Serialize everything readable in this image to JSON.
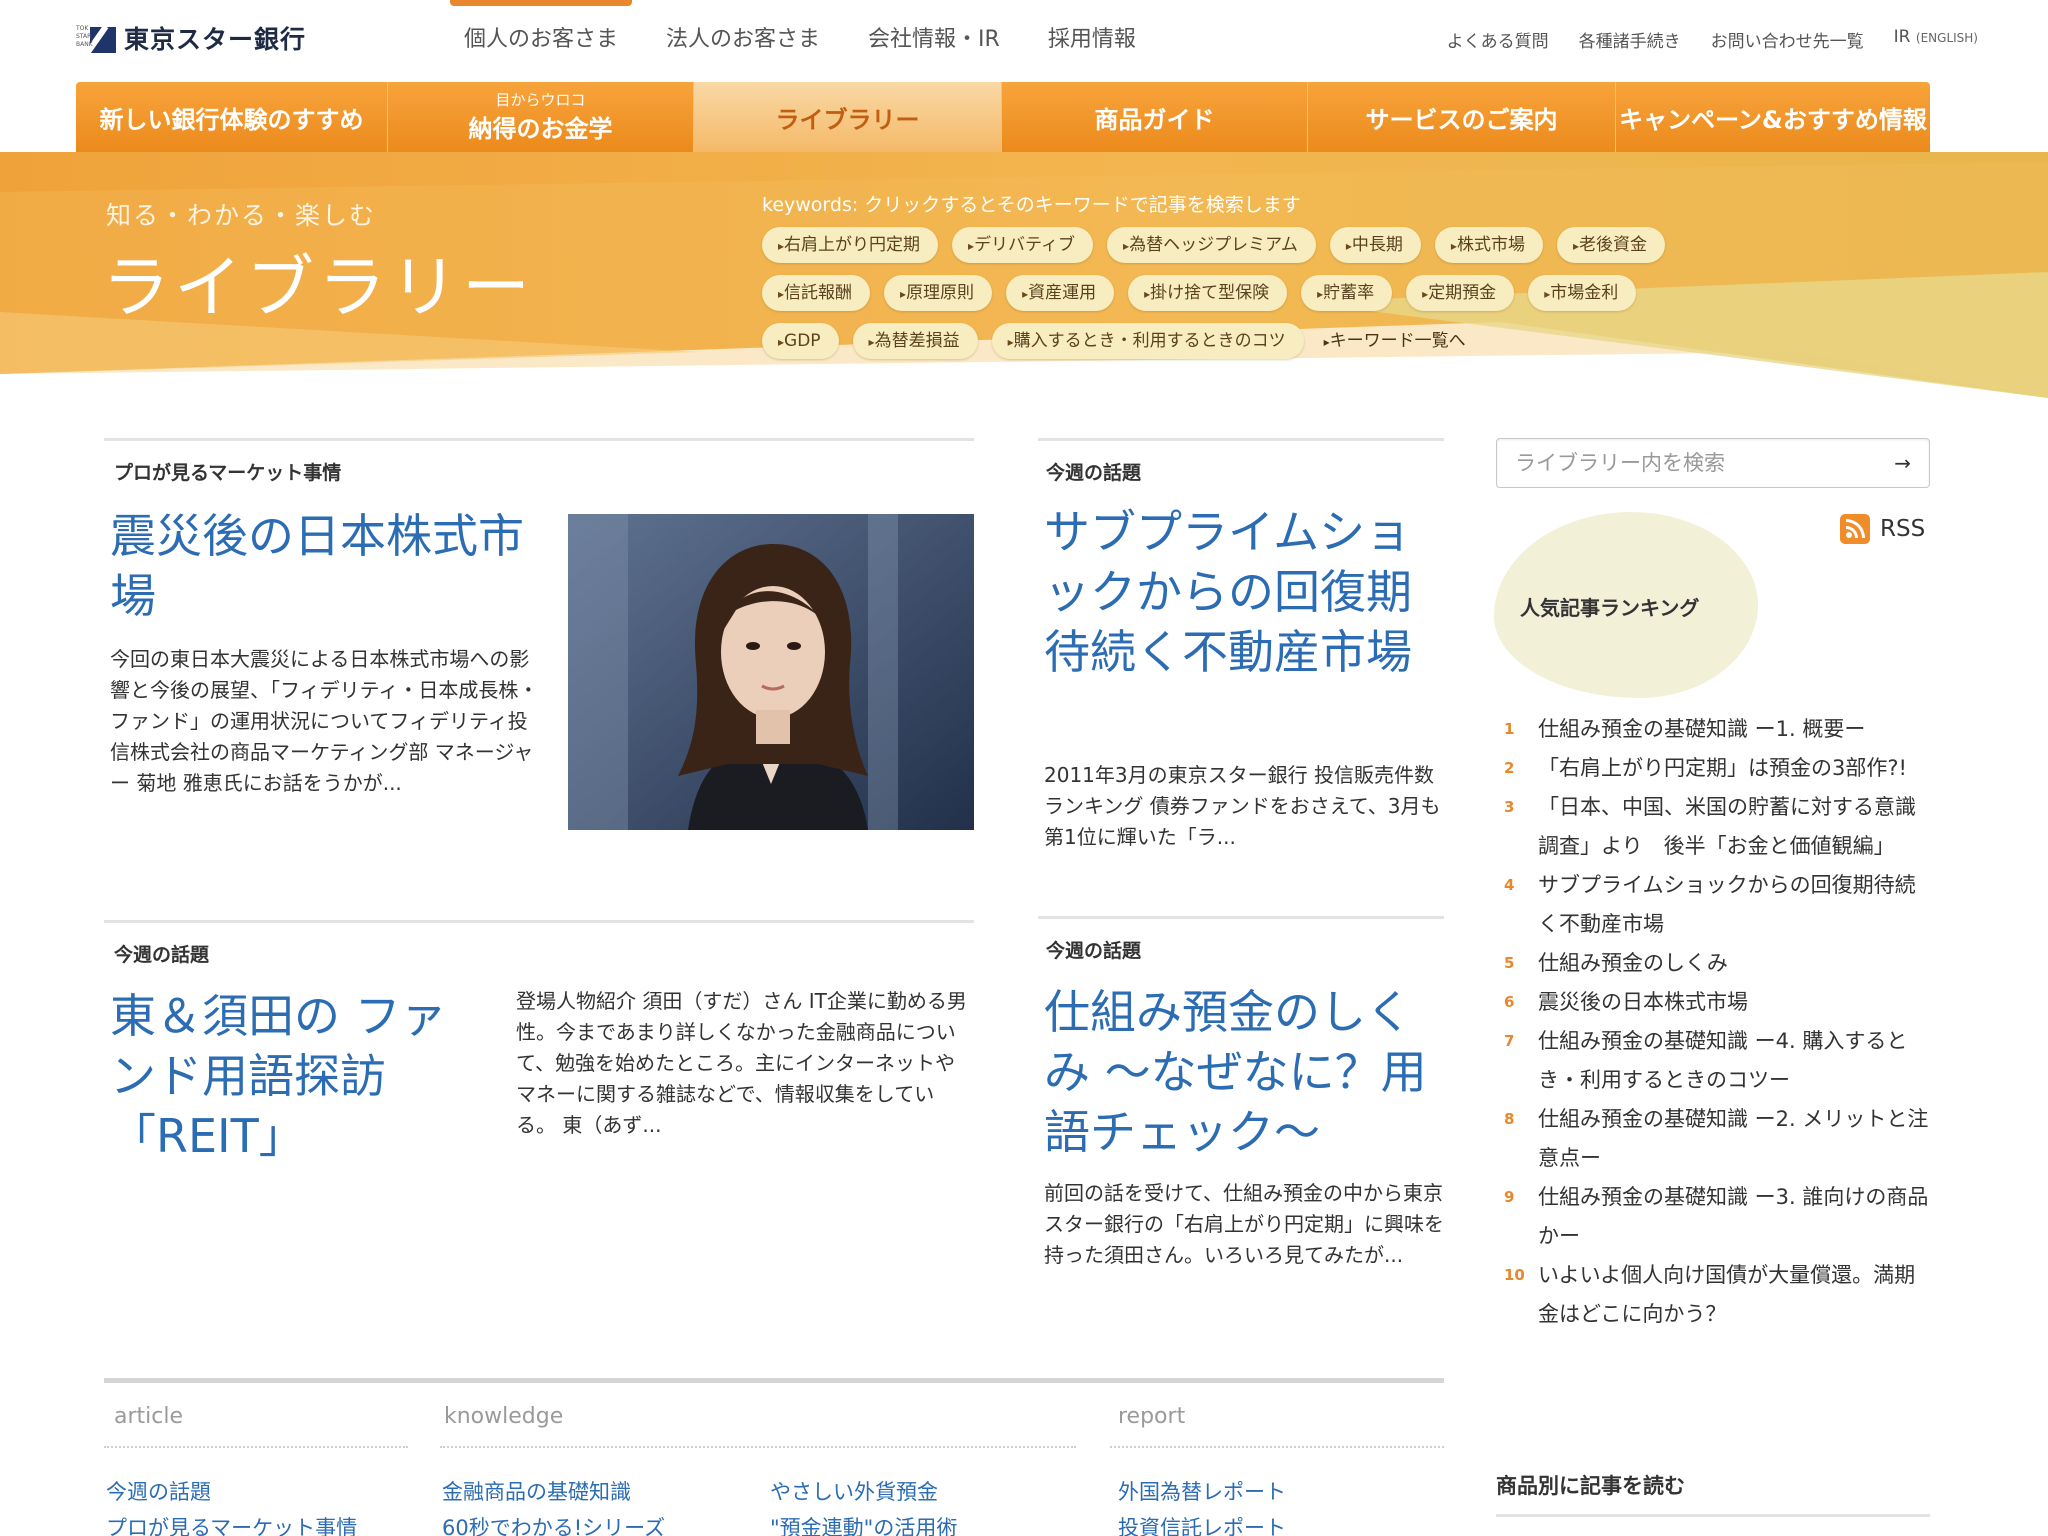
{
  "brand": {
    "name": "東京スター銀行",
    "mark_lines": "TOKYO STAR BANK"
  },
  "global_nav": [
    {
      "label": "個人のお客さま",
      "active": true
    },
    {
      "label": "法人のお客さま",
      "active": false
    },
    {
      "label": "会社情報・IR",
      "active": false
    },
    {
      "label": "採用情報",
      "active": false
    }
  ],
  "utility_nav": {
    "faq": "よくある質問",
    "procedures": "各種諸手続き",
    "contacts": "お問い合わせ先一覧",
    "ir": "IR",
    "ir_en": "(ENGLISH)"
  },
  "main_nav": [
    {
      "label": "新しい銀行体験のすすめ",
      "sub": ""
    },
    {
      "label": "納得のお金学",
      "sub": "目からウロコ"
    },
    {
      "label": "ライブラリー",
      "sub": ""
    },
    {
      "label": "商品ガイド",
      "sub": ""
    },
    {
      "label": "サービスのご案内",
      "sub": ""
    },
    {
      "label": "キャンペーン&おすすめ情報",
      "sub": ""
    }
  ],
  "hero": {
    "subtitle": "知る・わかる・楽しむ",
    "title": "ライブラリー",
    "keywords_caption": "keywords: クリックするとそのキーワードで記事を検索します",
    "keywords_row1": [
      "右肩上がり円定期",
      "デリバティブ",
      "為替ヘッジプレミアム",
      "中長期",
      "株式市場",
      "老後資金"
    ],
    "keywords_row2": [
      "信託報酬",
      "原理原則",
      "資産運用",
      "掛け捨て型保険",
      "貯蓄率",
      "定期預金",
      "市場金利"
    ],
    "keywords_row3": [
      "GDP",
      "為替差損益",
      "購入するとき・利用するときのコツ"
    ],
    "keywords_all": "キーワード一覧へ"
  },
  "articles": {
    "a1": {
      "section": "プロが見るマーケット事情",
      "title": "震災後の日本株式市場",
      "excerpt": "今回の東日本大震災による日本株式市場への影響と今後の展望、「フィデリティ・日本成長株・ファンド」の運用状況についてフィデリティ投信株式会社の商品マーケティング部 マネージャー 菊地 雅恵氏にお話をうかが..."
    },
    "a2": {
      "section": "今週の話題",
      "title": "サブプライムショックからの回復期待続く不動産市場",
      "excerpt": "2011年3月の東京スター銀行 投信販売件数ランキング 債券ファンドをおさえて、3月も第1位に輝いた「ラ..."
    },
    "a3": {
      "section": "今週の話題",
      "title": "東＆須田の ファンド用語探訪「REIT」",
      "excerpt": "登場人物紹介 須田（すだ）さん IT企業に勤める男性。今まであまり詳しくなかった金融商品について、勉強を始めたところ。主にインターネットやマネーに関する雑誌などで、情報収集をしている。 東（あず..."
    },
    "a4": {
      "section": "今週の話題",
      "title": "仕組み預金のしくみ ～なぜなに？用語チェック～",
      "excerpt": "前回の話を受けて、仕組み預金の中から東京スター銀行の「右肩上がり円定期」に興味を持った須田さん。いろいろ見てみたが..."
    }
  },
  "sidebar": {
    "search_placeholder": "ライブラリー内を検索",
    "search_arrow": "→",
    "rss_label": "RSS",
    "ranking_title": "人気記事ランキング",
    "ranking": [
      {
        "num": "1",
        "text": "仕組み預金の基礎知識 ー1. 概要ー"
      },
      {
        "num": "2",
        "text": "「右肩上がり円定期」は預金の3部作?!"
      },
      {
        "num": "3",
        "text": "「日本、中国、米国の貯蓄に対する意識調査」より　後半「お金と価値観編」"
      },
      {
        "num": "4",
        "text": "サブプライムショックからの回復期待続く不動産市場"
      },
      {
        "num": "5",
        "text": "仕組み預金のしくみ"
      },
      {
        "num": "6",
        "text": "震災後の日本株式市場"
      },
      {
        "num": "7",
        "text": "仕組み預金の基礎知識 ー4. 購入するとき・利用するときのコツー"
      },
      {
        "num": "8",
        "text": "仕組み預金の基礎知識 ー2. メリットと注意点ー"
      },
      {
        "num": "9",
        "text": "仕組み預金の基礎知識 ー3. 誰向けの商品かー"
      },
      {
        "num": "10",
        "text": "いよいよ個人向け国債が大量償還。満期金はどこに向かう？"
      }
    ],
    "by_category_title": "商品別に記事を読む"
  },
  "footer_nav": {
    "article": {
      "heading": "article",
      "links": [
        "今週の話題",
        "プロが見るマーケット事情"
      ]
    },
    "knowledge": {
      "heading": "knowledge",
      "links": [
        "金融商品の基礎知識",
        "60秒でわかる!シリーズ",
        "やさしい外貨預金",
        "\"預金連動\"の活用術"
      ]
    },
    "report": {
      "heading": "report",
      "links": [
        "外国為替レポート",
        "投資信託レポート"
      ]
    }
  },
  "colors": {
    "orange": "#ec8a1c",
    "link_blue": "#2b6cb3",
    "navy": "#1f3569",
    "keyword_bg": "#f8edc0"
  }
}
